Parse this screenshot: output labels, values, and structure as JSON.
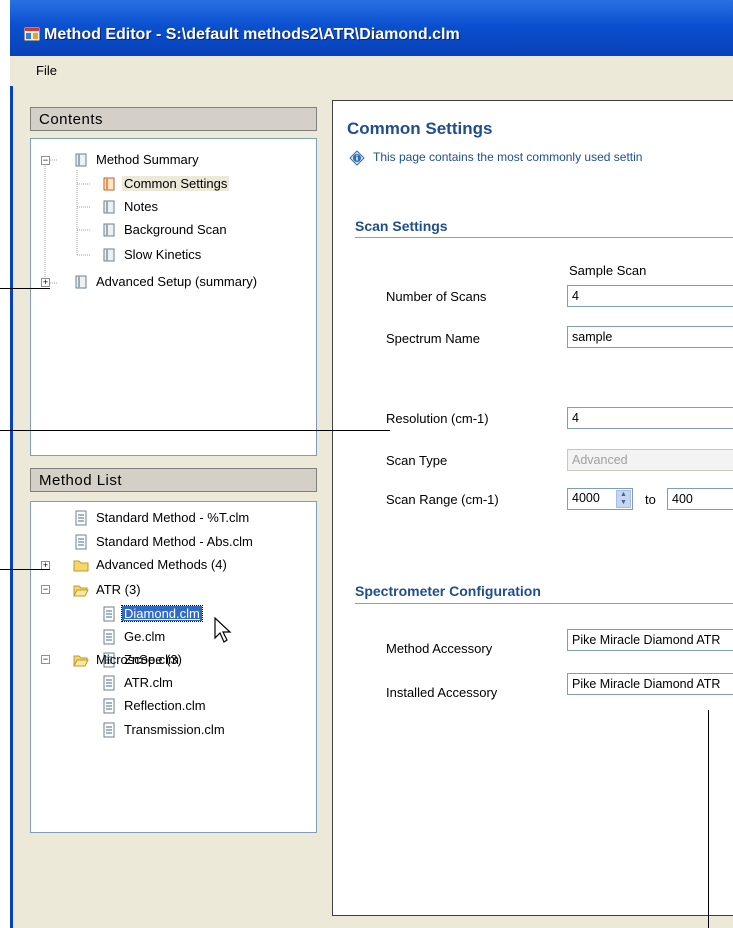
{
  "window": {
    "title": "Method Editor - S:\\default methods2\\ATR\\Diamond.clm"
  },
  "menu": {
    "file_label": "File"
  },
  "contents": {
    "header": "Contents",
    "items": [
      {
        "label": "Method Summary"
      },
      {
        "label": "Common Settings"
      },
      {
        "label": "Notes"
      },
      {
        "label": "Background Scan"
      },
      {
        "label": "Slow Kinetics"
      },
      {
        "label": "Advanced Setup (summary)"
      }
    ]
  },
  "method_list": {
    "header": "Method List",
    "items": [
      {
        "label": "Standard Method - %T.clm"
      },
      {
        "label": "Standard Method - Abs.clm"
      },
      {
        "label": "Advanced Methods (4)"
      },
      {
        "label": "ATR (3)"
      },
      {
        "label": "Diamond.clm"
      },
      {
        "label": "Ge.clm"
      },
      {
        "label": "ZnSe.clm"
      },
      {
        "label": "Microscope (3)"
      },
      {
        "label": "ATR.clm"
      },
      {
        "label": "Reflection.clm"
      },
      {
        "label": "Transmission.clm"
      }
    ]
  },
  "main": {
    "title": "Common Settings",
    "info": "This page contains the most commonly used settin",
    "scan_settings": {
      "title": "Scan Settings",
      "column_header": "Sample Scan",
      "number_of_scans_label": "Number of Scans",
      "number_of_scans_value": "4",
      "spectrum_name_label": "Spectrum Name",
      "spectrum_name_value": "sample",
      "resolution_label": "Resolution (cm-1)",
      "resolution_value": "4",
      "scan_type_label": "Scan Type",
      "scan_type_value": "Advanced",
      "scan_range_label": "Scan Range (cm-1)",
      "scan_range_from": "4000",
      "scan_range_to_label": "to",
      "scan_range_to": "400"
    },
    "spectrometer": {
      "title": "Spectrometer Configuration",
      "method_accessory_label": "Method Accessory",
      "method_accessory_value": "Pike Miracle Diamond ATR",
      "installed_accessory_label": "Installed Accessory",
      "installed_accessory_value": "Pike Miracle Diamond ATR"
    }
  },
  "colors": {
    "titlebar": "#0a50d0",
    "dialog_bg": "#ece9d8",
    "section_title": "#1f4e8c",
    "selection": "#316ac5"
  }
}
